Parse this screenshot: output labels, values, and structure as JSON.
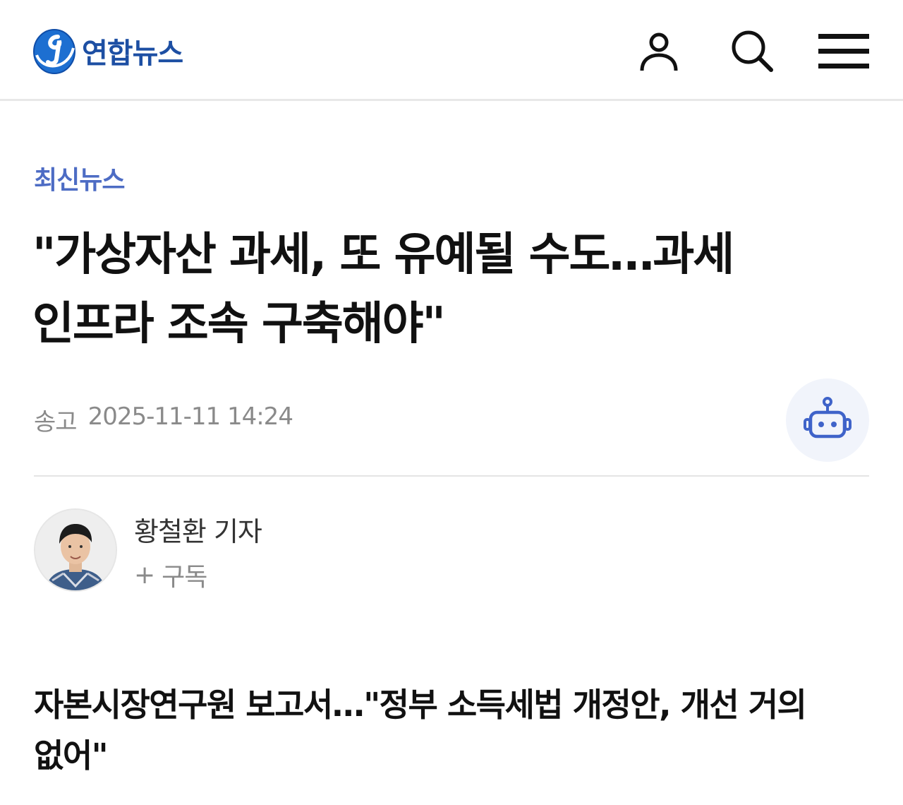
{
  "header": {
    "brand_name": "연합뉴스",
    "brand_color": "#1d4fa3",
    "icons": [
      "user-icon",
      "search-icon",
      "menu-icon"
    ]
  },
  "article": {
    "category": "최신뉴스",
    "category_color": "#4d6cc4",
    "headline_line1": "\"가상자산 과세, 또 유예될 수도…과세",
    "headline_line2": "인프라 조속 구축해야\"",
    "sent_label": "송고",
    "sent_datetime": "2025-11-11 14:24",
    "ai_button_icon": "robot-icon"
  },
  "reporter": {
    "name": "황철환 기자",
    "subscribe_plus": "+",
    "subscribe_label": "구독"
  },
  "subheadline": {
    "line1": "자본시장연구원 보고서…\"정부 소득세법 개정안, 개선 거의",
    "line2": "없어\""
  }
}
